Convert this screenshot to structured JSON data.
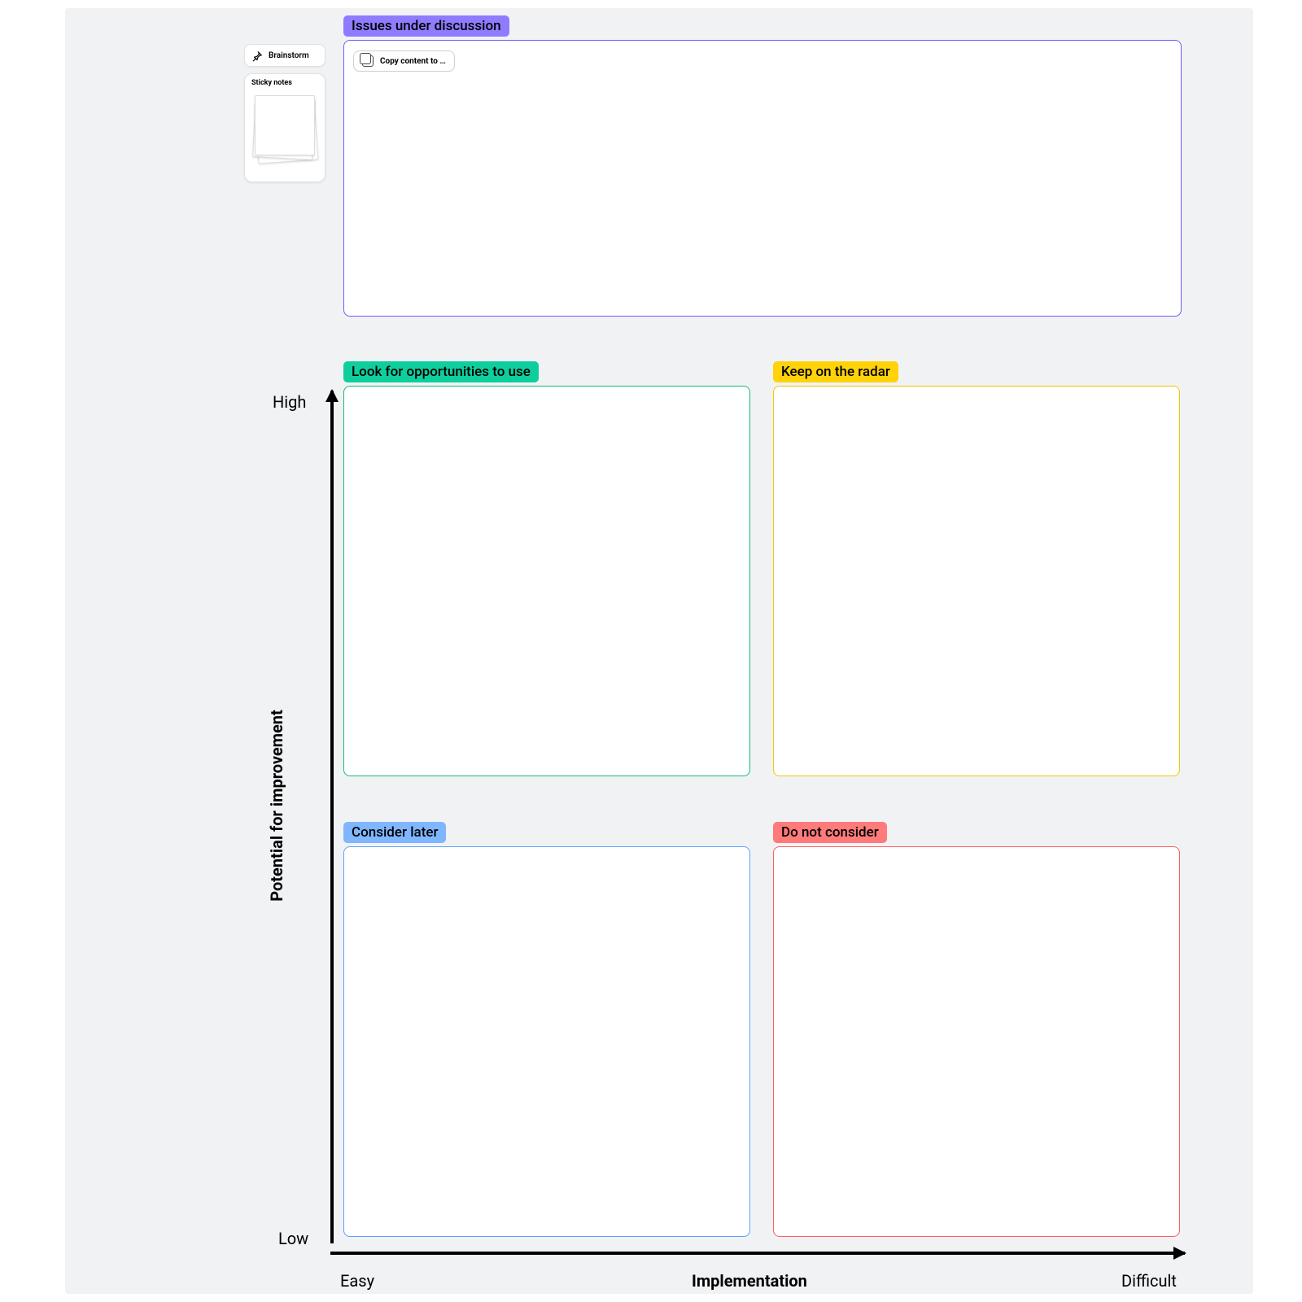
{
  "sidebar": {
    "brainstorm_label": "Brainstorm",
    "sticky_title": "Sticky notes"
  },
  "copy_button": {
    "label": "Copy content to …"
  },
  "issues": {
    "label": "Issues under discussion"
  },
  "quadrants": {
    "green": {
      "label": "Look for opportunities to use"
    },
    "yellow": {
      "label": "Keep on the radar"
    },
    "blue": {
      "label": "Consider later"
    },
    "red": {
      "label": "Do not consider"
    }
  },
  "axes": {
    "y_label": "Potential for improvement",
    "y_high": "High",
    "y_low": "Low",
    "x_label": "Implementation",
    "x_easy": "Easy",
    "x_difficult": "Difficult"
  },
  "colors": {
    "purple": "#8f7bff",
    "green": "#0fce9d",
    "yellow": "#ffd20a",
    "blue": "#7fb6ff",
    "red": "#ff7a7a"
  },
  "chart_data": {
    "type": "table",
    "title": "2x2 prioritization matrix",
    "x_axis": {
      "label": "Implementation",
      "low": "Easy",
      "high": "Difficult"
    },
    "y_axis": {
      "label": "Potential for improvement",
      "low": "Low",
      "high": "High"
    },
    "quadrants": [
      {
        "x": "Easy",
        "y": "High",
        "label": "Look for opportunities to use",
        "color": "#0fce9d"
      },
      {
        "x": "Difficult",
        "y": "High",
        "label": "Keep on the radar",
        "color": "#ffd20a"
      },
      {
        "x": "Easy",
        "y": "Low",
        "label": "Consider later",
        "color": "#7fb6ff"
      },
      {
        "x": "Difficult",
        "y": "Low",
        "label": "Do not consider",
        "color": "#ff7a7a"
      }
    ],
    "extra_panel": {
      "label": "Issues under discussion",
      "color": "#8f7bff"
    }
  }
}
